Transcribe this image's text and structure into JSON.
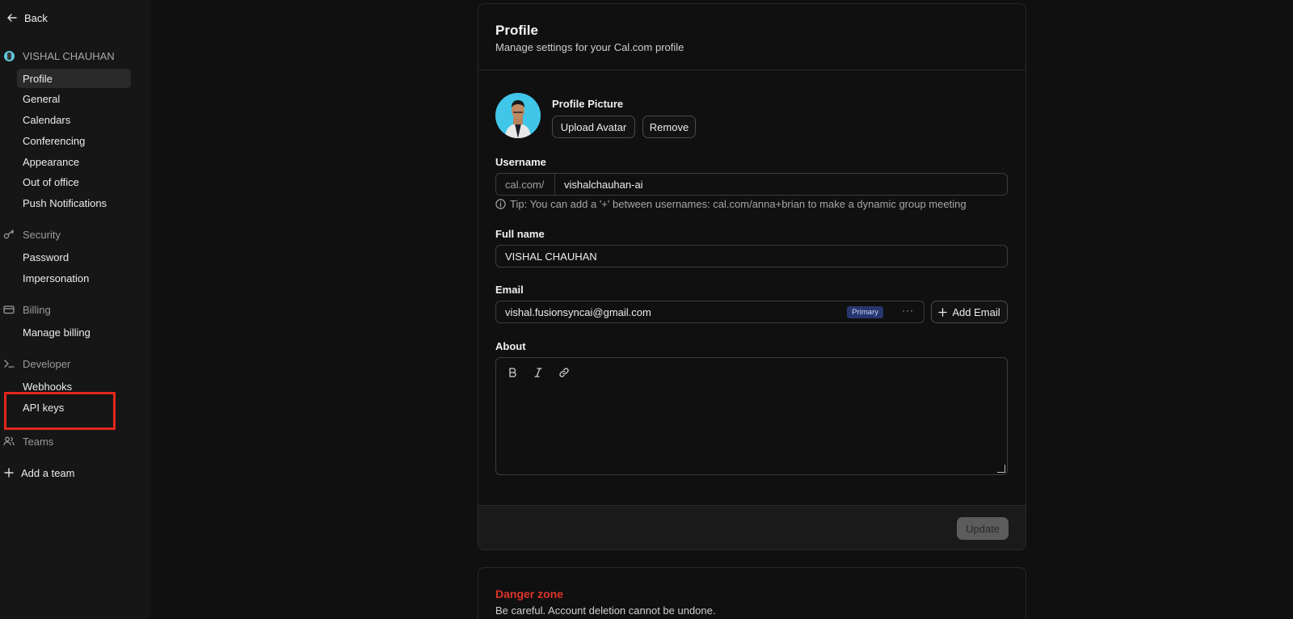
{
  "sidebar": {
    "back_label": "Back",
    "user_name": "VISHAL CHAUHAN",
    "account_items": [
      "Profile",
      "General",
      "Calendars",
      "Conferencing",
      "Appearance",
      "Out of office",
      "Push Notifications"
    ],
    "security": {
      "label": "Security",
      "items": [
        "Password",
        "Impersonation"
      ]
    },
    "billing": {
      "label": "Billing",
      "items": [
        "Manage billing"
      ]
    },
    "developer": {
      "label": "Developer",
      "items": [
        "Webhooks",
        "API keys"
      ]
    },
    "teams": {
      "label": "Teams"
    },
    "add_team_label": "Add a team",
    "active_item": "Profile",
    "highlight_color": "#e3261c"
  },
  "profile": {
    "title": "Profile",
    "subtitle": "Manage settings for your Cal.com profile",
    "picture_label": "Profile Picture",
    "upload_button": "Upload Avatar",
    "remove_button": "Remove",
    "username_label": "Username",
    "username_prefix": "cal.com/",
    "username_value": "vishalchauhan-ai",
    "tip": "Tip: You can add a '+' between usernames: cal.com/anna+brian to make a dynamic group meeting",
    "fullname_label": "Full name",
    "fullname_value": "VISHAL CHAUHAN",
    "email_label": "Email",
    "email_value": "vishal.fusionsyncai@gmail.com",
    "email_badge": "Primary",
    "email_more": "···",
    "add_email_button": "Add Email",
    "about_label": "About",
    "about_value": "",
    "update_button": "Update"
  },
  "danger": {
    "title": "Danger zone",
    "subtitle": "Be careful. Account deletion cannot be undone."
  }
}
